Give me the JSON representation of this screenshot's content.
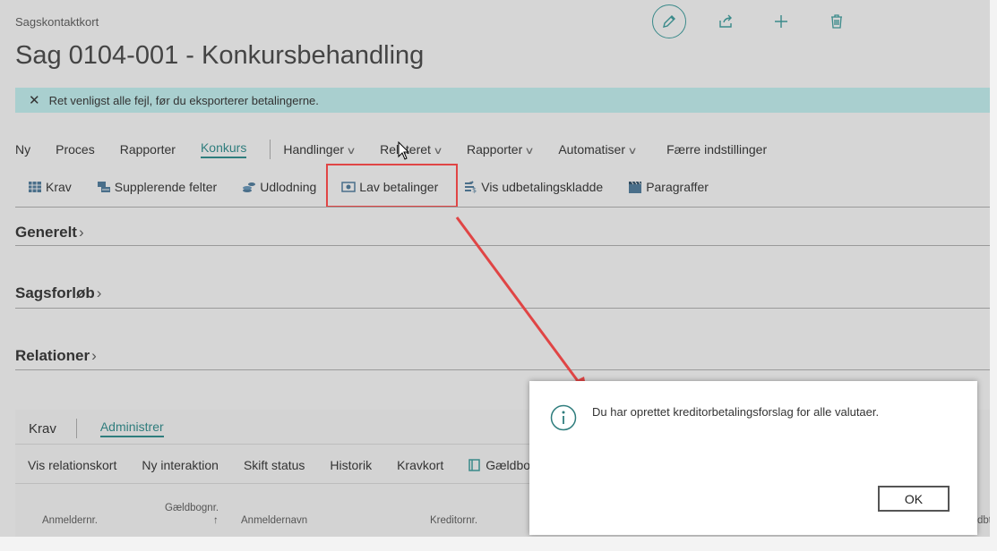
{
  "header": {
    "caption": "Sagskontaktkort",
    "title": "Sag 0104-001 - Konkursbehandling",
    "actions": [
      "pencil-icon",
      "share-icon",
      "plus-icon",
      "trash-icon"
    ]
  },
  "banner": {
    "message": "Ret venligst alle fejl, før du eksporterer betalingerne."
  },
  "menu": {
    "items": [
      "Ny",
      "Proces",
      "Rapporter",
      "Konkurs"
    ],
    "dropdowns": [
      "Handlinger",
      "Relateret",
      "Rapporter",
      "Automatiser"
    ],
    "fewer": "Færre indstillinger",
    "active": "Konkurs"
  },
  "toolbar": {
    "items": [
      "Krav",
      "Supplerende felter",
      "Udlodning",
      "Lav betalinger",
      "Vis udbetalingskladde",
      "Paragraffer"
    ]
  },
  "sections": [
    "Generelt",
    "Sagsforløb",
    "Relationer"
  ],
  "lower": {
    "tabs": [
      "Krav",
      "Administrer"
    ],
    "tools": [
      "Vis relationskort",
      "Ny interaktion",
      "Skift status",
      "Historik",
      "Kravkort",
      "Gældbo"
    ],
    "columns": [
      "Anmeldernr.",
      "Gældbognr.",
      "Anmeldernavn",
      "Kreditornr.",
      "dbt"
    ],
    "sort_arrow": "↑"
  },
  "dialog": {
    "message": "Du har oprettet kreditorbetalingsforslag for alle valutaer.",
    "ok": "OK"
  },
  "colors": {
    "accent": "#2f7d7d",
    "banner": "#a9cfcf",
    "annotation": "#e04545"
  }
}
